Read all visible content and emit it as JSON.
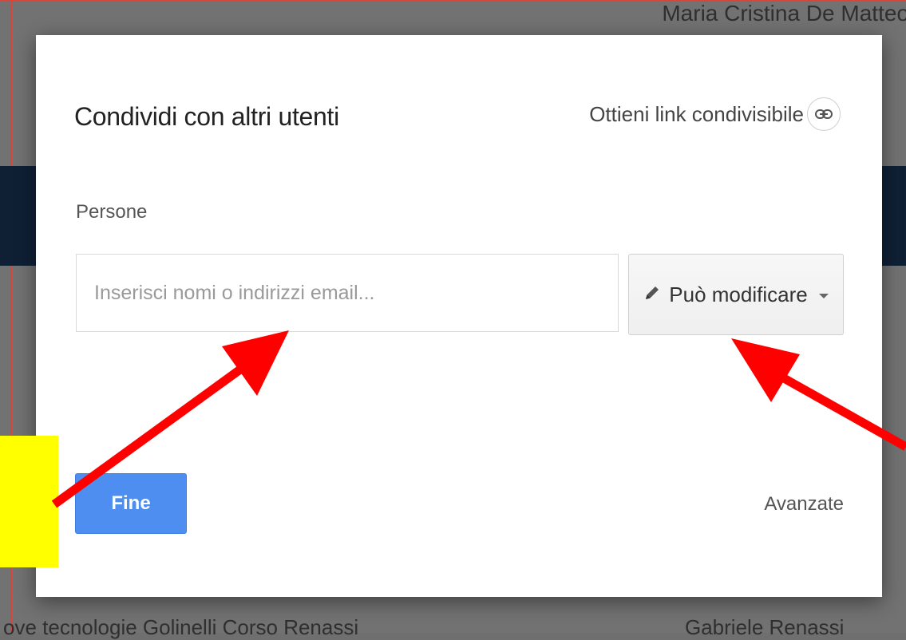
{
  "background": {
    "top_right_text": "Maria Cristina De Matteo",
    "bottom_left_text": "ove tecnologie Golinelli Corso Renassi",
    "bottom_right_text": "Gabriele Renassi"
  },
  "dialog": {
    "title": "Condividi con altri utenti",
    "share_link_label": "Ottieni link condivisibile",
    "people_label": "Persone",
    "input_placeholder": "Inserisci nomi o indirizzi email...",
    "permission_label": "Può modificare",
    "done_label": "Fine",
    "advanced_label": "Avanzate"
  },
  "colors": {
    "primary_button": "#4d8ef0",
    "annotation_arrow": "#ff0000",
    "annotation_box": "#ffff00"
  },
  "icons": {
    "share_link": "link-icon",
    "permission": "pencil-icon",
    "dropdown": "caret-down-icon"
  }
}
